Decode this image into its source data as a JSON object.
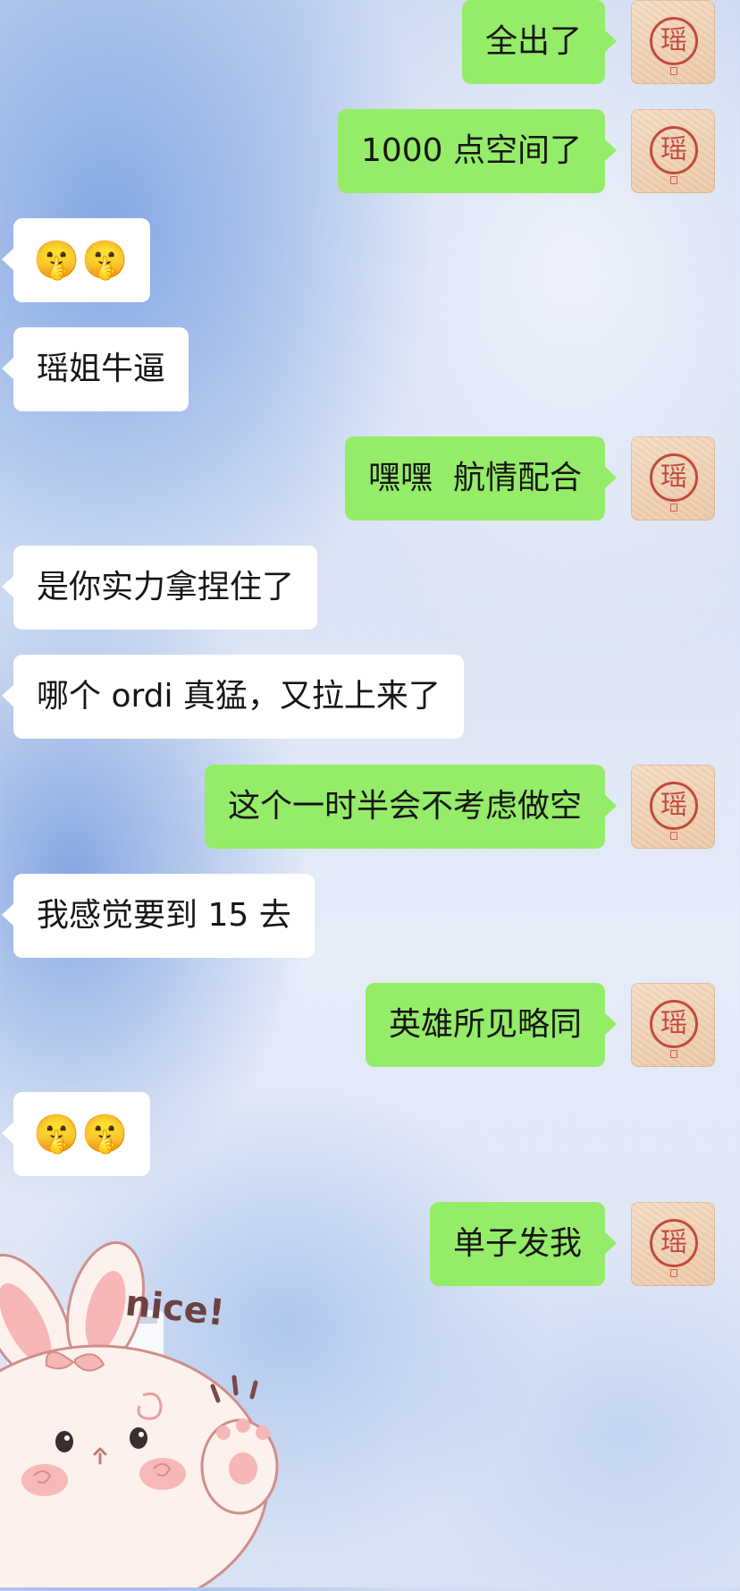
{
  "chat": {
    "messages": [
      {
        "side": "out",
        "text": "全出了"
      },
      {
        "side": "out",
        "text": "1000 点空间了"
      },
      {
        "side": "in",
        "text": "🤫🤫"
      },
      {
        "side": "in",
        "text": "瑶姐牛逼"
      },
      {
        "side": "out",
        "text": "嘿嘿  航情配合"
      },
      {
        "side": "in",
        "text": "是你实力拿捏住了"
      },
      {
        "side": "in",
        "text": "哪个 ordi 真猛，又拉上来了"
      },
      {
        "side": "out",
        "text": "这个一时半会不考虑做空"
      },
      {
        "side": "in",
        "text": "我感觉要到 15 去"
      },
      {
        "side": "out",
        "text": "英雄所见略同"
      },
      {
        "side": "in",
        "text": "🤫🤫"
      },
      {
        "side": "out",
        "text": "单子发我"
      }
    ],
    "self_avatar": {
      "glyph": "瑶",
      "icon": "seal-avatar-icon"
    }
  },
  "sticker": {
    "text": "nice!",
    "icon": "bunny-waving-sticker"
  },
  "colors": {
    "outgoing_bubble": "#95ec69",
    "incoming_bubble": "#ffffff",
    "seal_red": "#c24a3c"
  }
}
